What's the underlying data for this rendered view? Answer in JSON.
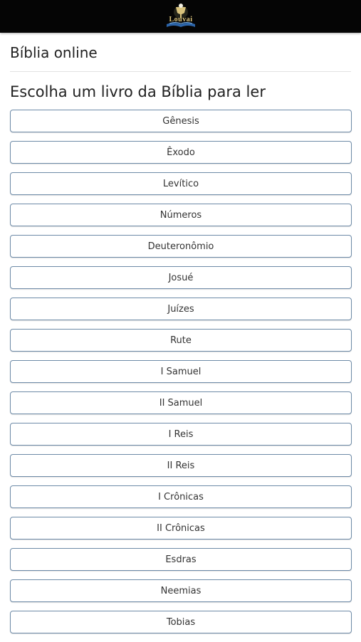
{
  "header": {
    "logo_text": "Louvai"
  },
  "page": {
    "site_title": "Bíblia online",
    "heading": "Escolha um livro da Bíblia para ler"
  },
  "books": [
    "Gênesis",
    "Êxodo",
    "Levítico",
    "Números",
    "Deuteronômio",
    "Josué",
    "Juízes",
    "Rute",
    "I Samuel",
    "II Samuel",
    "I Reis",
    "II Reis",
    "I Crônicas",
    "II Crônicas",
    "Esdras",
    "Neemias",
    "Tobias"
  ],
  "colors": {
    "header_bg": "#050505",
    "button_border": "#6d8aa7",
    "logo_accent": "#d9c27a"
  },
  "icons": {
    "logo": "chalice-and-book-logo"
  }
}
